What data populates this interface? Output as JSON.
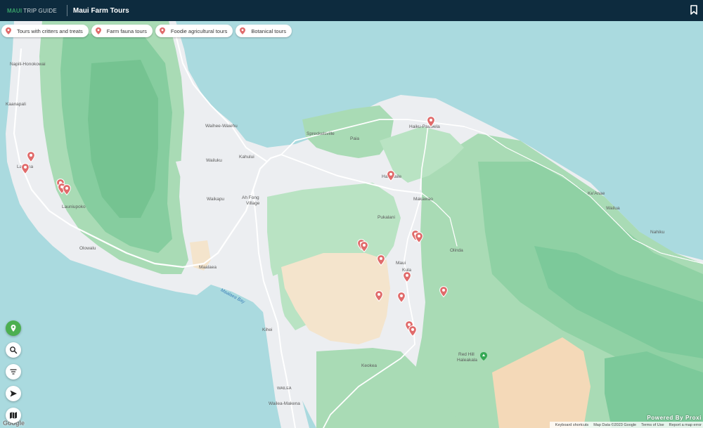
{
  "header": {
    "logo_maui": "MAUI",
    "logo_trip": "TRIP GUIDE",
    "title": "Maui Farm Tours"
  },
  "chips": [
    {
      "label": "Tours with critters and treats"
    },
    {
      "label": "Farm fauna tours"
    },
    {
      "label": "Foodie agricultural tours"
    },
    {
      "label": "Botanical tours"
    }
  ],
  "places": {
    "napili": "Napili-Honokowai",
    "kaanapali": "Kaanapali",
    "lahaina": "Lahaina",
    "launiupoko": "Launiupoko",
    "olowalu": "Olowalu",
    "waihee": "Waihee-Waiehu",
    "wailuku": "Wailuku",
    "kahului": "Kahului",
    "waikapu": "Waikapu",
    "ahfong": "Ah Fong",
    "village": "Village",
    "maalaea": "Maalaea",
    "maalaea_bay": "Maalaea Bay",
    "kihei": "Kihei",
    "wailea": "WAILEA",
    "wailea_makena": "Wailea-Makena",
    "spreckelsville": "Spreckelsville",
    "paia": "Paia",
    "haiku": "Haiku-Pauwela",
    "haliimaile": "Haliimaile",
    "makawao": "Makawao",
    "pukalani": "Pukalani",
    "olinda": "Olinda",
    "kula": "Kula",
    "keokea": "Keokea",
    "keanae": "Ke'Anae",
    "wailua": "Wailua",
    "nahiku": "Nahiku",
    "red_hill": "Red Hill",
    "haleakala": "Haleakala",
    "maui": "Maui"
  },
  "map": {
    "marker_count": 18,
    "colors": {
      "water": "#aadadf",
      "land": "#eceef1",
      "forest": "#a9dbb5",
      "forest_dark": "#7cc99a",
      "sand": "#f4e4cc",
      "marker": "#e06b6b",
      "header": "#0d2b3e",
      "accent": "#4caf50"
    }
  },
  "tools": {
    "locate": "pin-icon",
    "search": "search-icon",
    "filter": "filter-icon",
    "directions": "navigate-icon",
    "layers": "map-icon"
  },
  "attribution": {
    "keyboard": "Keyboard shortcuts",
    "data": "Map Data ©2023 Google",
    "terms": "Terms of Use",
    "report": "Report a map error",
    "powered": "Powered By Proxi",
    "google": "Google"
  }
}
